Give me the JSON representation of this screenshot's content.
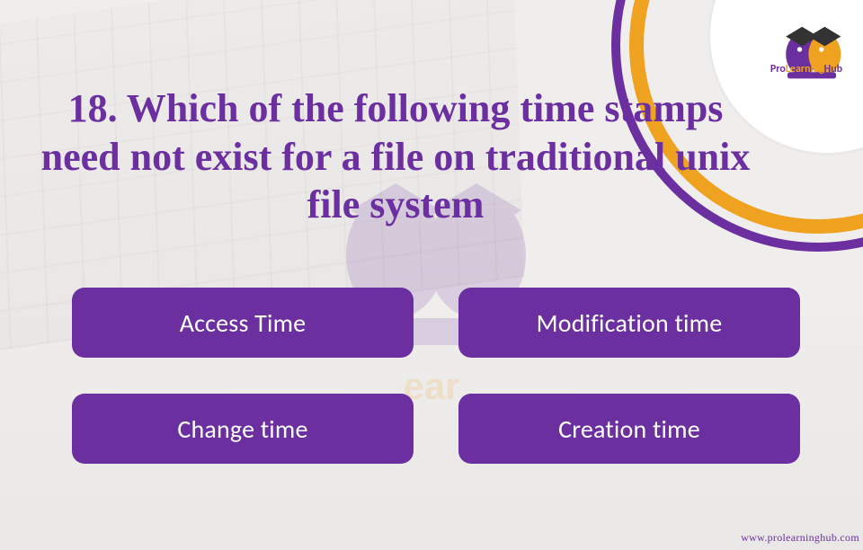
{
  "brand": {
    "name_part1": "Pro",
    "name_part2": "Learning",
    "name_part3": "Hub"
  },
  "question": {
    "number": "18.",
    "text": "Which of the following time stamps need not exist for a file on traditional unix file system"
  },
  "options": [
    {
      "label": "Access Time"
    },
    {
      "label": "Modification time"
    },
    {
      "label": "Change time"
    },
    {
      "label": "Creation time"
    }
  ],
  "footer": {
    "url": "www.prolearninghub.com"
  },
  "colors": {
    "primary": "#6b2fa0",
    "accent": "#efa21f"
  }
}
